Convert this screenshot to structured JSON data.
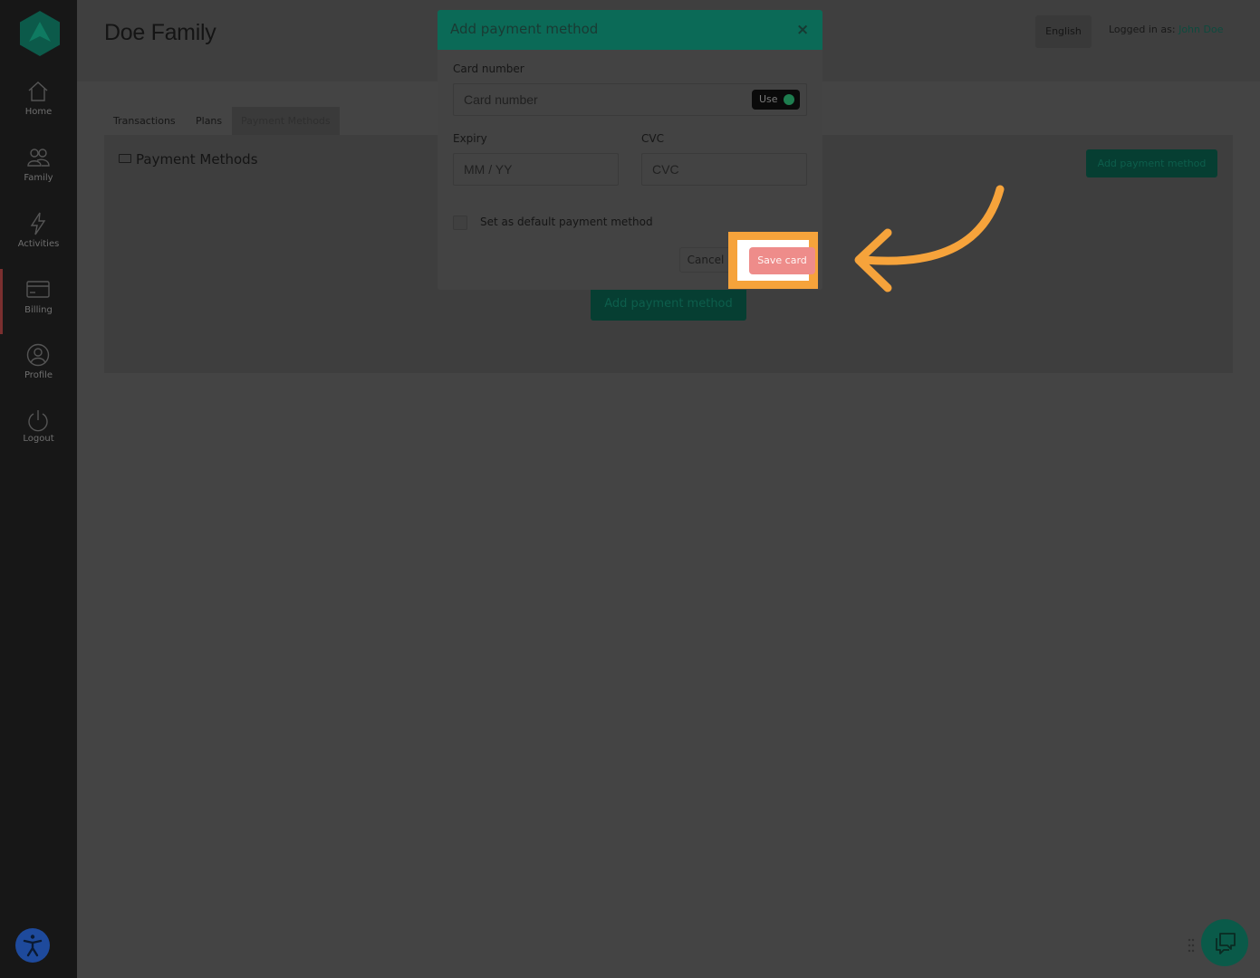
{
  "sidebar": {
    "items": [
      {
        "label": "Home",
        "icon": "home-icon"
      },
      {
        "label": "Family",
        "icon": "family-icon"
      },
      {
        "label": "Activities",
        "icon": "lightning-icon"
      },
      {
        "label": "Billing",
        "icon": "credit-card-icon",
        "active": true
      },
      {
        "label": "Profile",
        "icon": "user-icon"
      },
      {
        "label": "Logout",
        "icon": "power-icon"
      }
    ]
  },
  "header": {
    "title": "Doe Family",
    "language": "English",
    "logged_in_prefix": "Logged in as: ",
    "user_name": "John Doe"
  },
  "tabs": [
    {
      "label": "Transactions"
    },
    {
      "label": "Plans"
    },
    {
      "label": "Payment Methods",
      "active": true
    }
  ],
  "panel": {
    "title": "Payment Methods",
    "add_button_label": "Add payment method",
    "add_button_center_label": "Add payment method"
  },
  "modal": {
    "title": "Add payment method",
    "close_label": "×",
    "card_number_label": "Card number",
    "card_number_placeholder": "Card number",
    "use_button_label": "Use",
    "expiry_label": "Expiry",
    "expiry_placeholder": "MM / YY",
    "cvc_label": "CVC",
    "cvc_placeholder": "CVC",
    "default_checkbox_label": "Set as default payment method",
    "default_checked": false,
    "cancel_label": "Cancel",
    "save_label": "Save card"
  },
  "colors": {
    "brand_green": "#0b6a57",
    "highlight_orange": "#f6a33b",
    "save_button": "#ee8c8a"
  }
}
